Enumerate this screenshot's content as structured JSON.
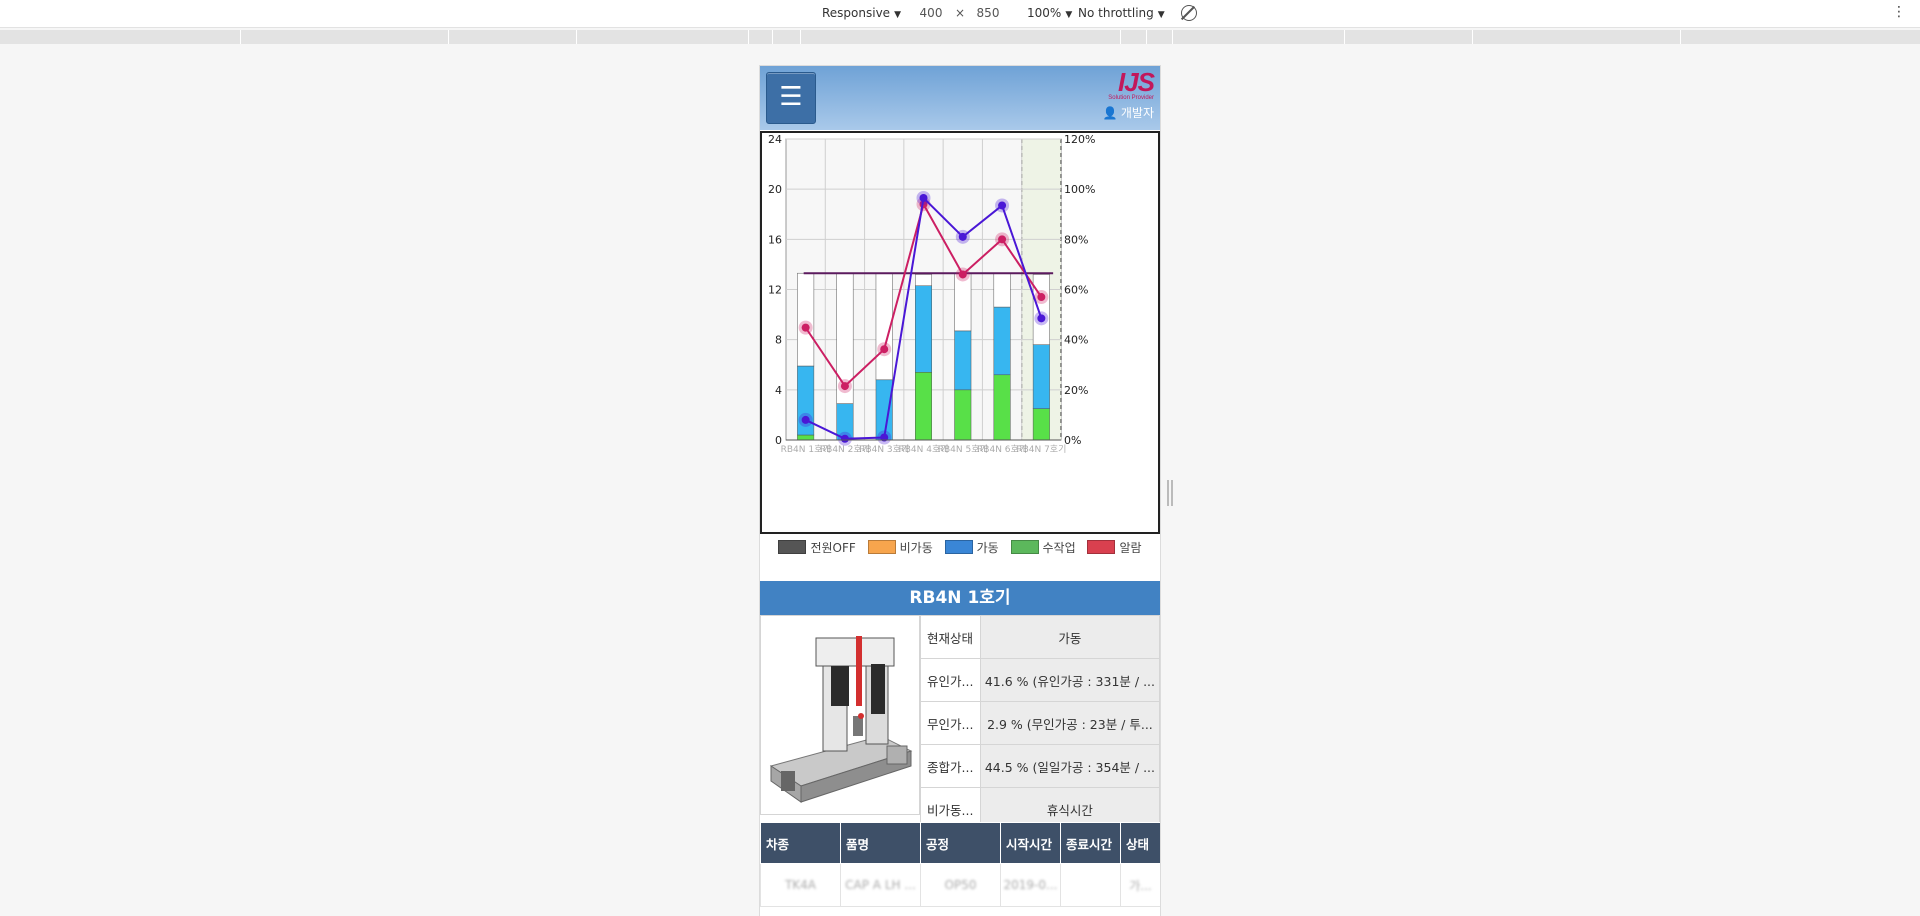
{
  "devtools": {
    "device_mode": "Responsive",
    "width": "400",
    "times": "×",
    "height": "850",
    "zoom": "100%",
    "throttling": "No throttling"
  },
  "header": {
    "menu_icon": "☰",
    "logo": "IJS",
    "logo_sub": "Solution Provider",
    "user_label": "개발자"
  },
  "chart_data": {
    "type": "bar",
    "categories": [
      "RB4N 1호기",
      "RB4N 2호기",
      "RB4N 3호기",
      "RB4N 4호기",
      "RB4N 5호기",
      "RB4N 6호기",
      "RB4N 7호기"
    ],
    "left_axis": {
      "ticks": [
        "0",
        "4",
        "8",
        "12",
        "16",
        "20",
        "24"
      ],
      "ylim": [
        0,
        24
      ]
    },
    "right_axis": {
      "ticks": [
        "0%",
        "20%",
        "40%",
        "60%",
        "80%",
        "100%",
        "120%"
      ],
      "ylim": [
        0,
        120
      ]
    },
    "stacked_series": [
      {
        "name": "수작업",
        "color": "#58e048",
        "values": [
          0.4,
          0,
          0,
          5.4,
          4.0,
          5.2,
          2.5
        ]
      },
      {
        "name": "가동",
        "color": "#37b6f0",
        "values": [
          5.5,
          2.9,
          4.8,
          6.9,
          4.7,
          5.4,
          5.1
        ]
      },
      {
        "name": "비가동(빈)",
        "color": "#ffffff",
        "values": [
          7.4,
          10.4,
          8.5,
          0.9,
          4.6,
          2.7,
          5.6
        ]
      }
    ],
    "line_series": [
      {
        "color": "#cc1f63",
        "values": [
          44.8,
          21.5,
          36.2,
          94.0,
          66.0,
          80.0,
          57.0
        ]
      },
      {
        "color": "#4a17d6",
        "values": [
          8.0,
          0.5,
          1.0,
          96.5,
          81.0,
          93.5,
          48.5
        ]
      }
    ],
    "target_line": {
      "value": 66.5,
      "color": "#5b1a5e"
    },
    "highlight_category": 6
  },
  "legend": [
    {
      "label": "전원OFF",
      "color": "#555555"
    },
    {
      "label": "비가동",
      "color": "#f7a54d"
    },
    {
      "label": "가동",
      "color": "#3a86d6"
    },
    {
      "label": "수작업",
      "color": "#5cb85c"
    },
    {
      "label": "알람",
      "color": "#d9404f"
    }
  ],
  "machine": {
    "title": "RB4N 1호기",
    "rows": [
      {
        "label": "현재상태",
        "value": "가동"
      },
      {
        "label": "유인가...",
        "value": "41.6 % (유인가공 : 331분 / ..."
      },
      {
        "label": "무인가...",
        "value": "2.9 % (무인가공 : 23분 / 투..."
      },
      {
        "label": "종합가...",
        "value": "44.5 % (일일가공 : 354분 / ..."
      },
      {
        "label": "비가동...",
        "value": "휴식시간"
      }
    ]
  },
  "work_table": {
    "headers": [
      "차종",
      "품명",
      "공정",
      "시작시간",
      "종료시간",
      "상태"
    ],
    "row": [
      "TK4A",
      "CAP A LH ...",
      "OP50",
      "2019-0...",
      "",
      "가..."
    ]
  }
}
